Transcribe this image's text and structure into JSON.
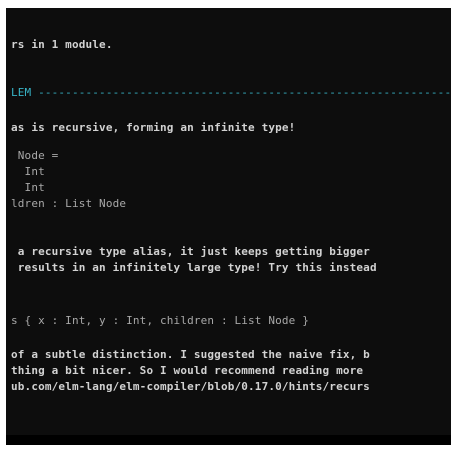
{
  "terminal": {
    "lines": [
      {
        "text": "rs in 1 module."
      },
      {
        "text": "LEM ------------------------------------------------------------------"
      },
      {
        "text": "as is recursive, forming an infinite type!"
      },
      {
        "text": " Node ="
      },
      {
        "text": "  Int"
      },
      {
        "text": "  Int"
      },
      {
        "text": "ldren : List Node"
      },
      {
        "text": " a recursive type alias, it just keeps getting bigger"
      },
      {
        "text": " results in an infinitely large type! Try this instead"
      },
      {
        "text": "s { x : Int, y : Int, children : List Node }"
      },
      {
        "text": "of a subtle distinction. I suggested the naive fix, b"
      },
      {
        "text": "thing a bit nicer. So I would recommend reading more"
      },
      {
        "text": "ub.com/elm-lang/elm-compiler/blob/0.17.0/hints/recurs"
      }
    ]
  },
  "colors": {
    "background": "#0d0d0d",
    "text": "#d2d2d2",
    "dim_text": "#a8a8a8",
    "header_cyan": "#38b5c8"
  }
}
